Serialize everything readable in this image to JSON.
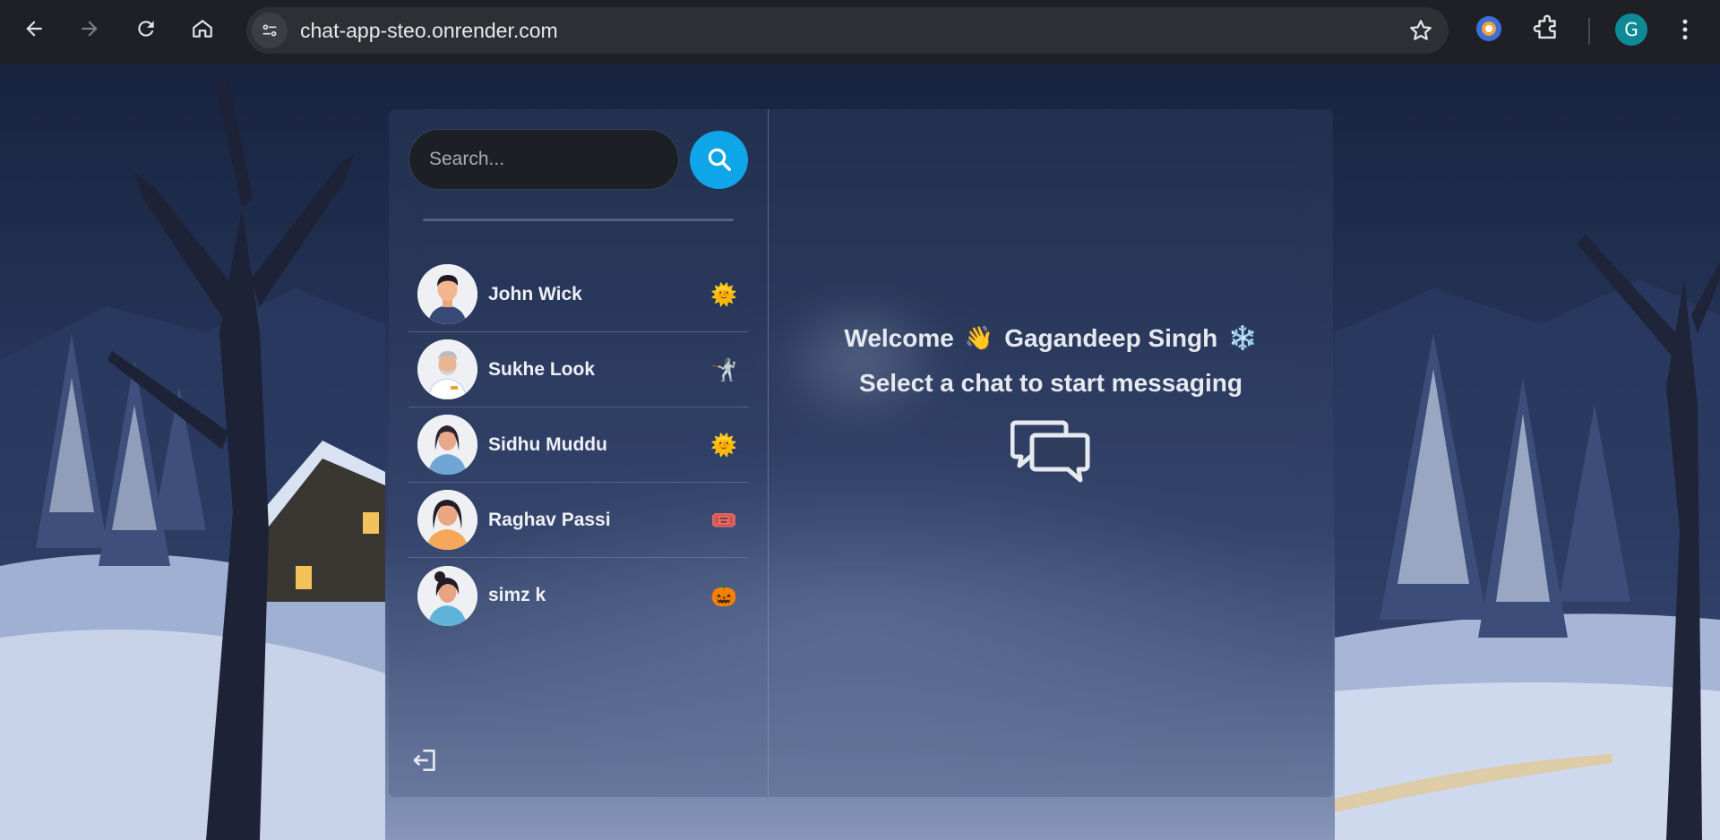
{
  "browser": {
    "url": "chat-app-steo.onrender.com",
    "profile_initial": "G"
  },
  "sidebar": {
    "search_placeholder": "Search...",
    "conversations": [
      {
        "name": "John Wick",
        "emoji": "🌞"
      },
      {
        "name": "Sukhe Look",
        "emoji": "🤺"
      },
      {
        "name": "Sidhu Muddu",
        "emoji": "🌞"
      },
      {
        "name": "Raghav Passi",
        "emoji": "🎟️"
      },
      {
        "name": "simz k",
        "emoji": "🎃"
      }
    ]
  },
  "main": {
    "welcome_prefix": "Welcome",
    "wave_emoji": "👋",
    "user_name": "Gagandeep Singh",
    "snow_emoji": "❄️",
    "subtitle": "Select a chat to start messaging"
  },
  "colors": {
    "accent": "#0ea5e9",
    "browser_bar": "#1f2025",
    "address_bar": "#2e2f34",
    "profile": "#0e8a97"
  }
}
